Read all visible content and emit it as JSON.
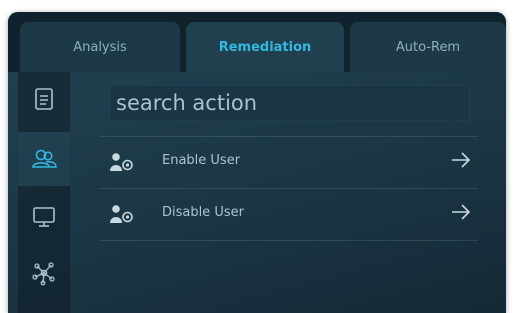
{
  "tabs": [
    {
      "label": "Analysis"
    },
    {
      "label": "Remediation"
    },
    {
      "label": "Auto-Rem"
    }
  ],
  "search": {
    "placeholder": "search action"
  },
  "actions": [
    {
      "label": "Enable User"
    },
    {
      "label": "Disable User"
    }
  ],
  "sidebar_icons": [
    "document-icon",
    "users-icon",
    "monitor-icon",
    "network-icon"
  ],
  "colors": {
    "accent": "#32b9e0",
    "text": "#a9c3cf",
    "panel_bg": "#1b3645"
  }
}
